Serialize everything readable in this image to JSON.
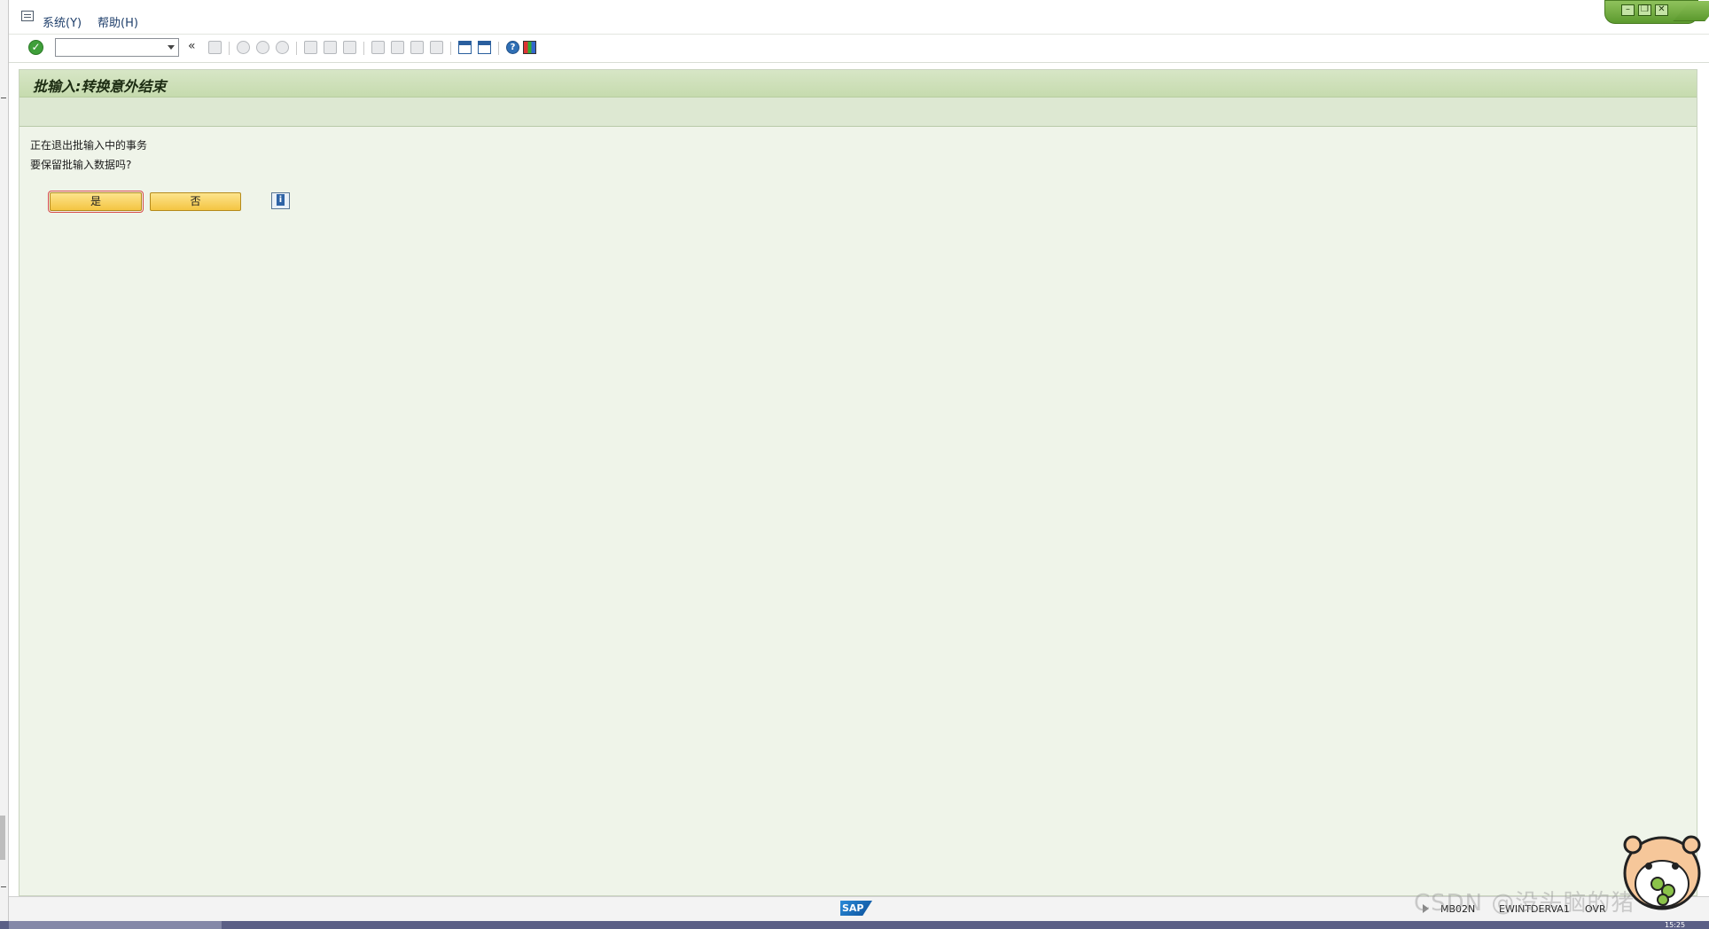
{
  "menu": {
    "items": [
      {
        "label": "系统(Y)"
      },
      {
        "label": "帮助(H)"
      }
    ]
  },
  "toolbar": {
    "command_field_value": "",
    "back_glyph": "«"
  },
  "page": {
    "title": "批输入:转换意外结束",
    "messages": [
      "正在退出批输入中的事务",
      "要保留批输入数据吗?"
    ],
    "buttons": {
      "yes": "是",
      "no": "否"
    }
  },
  "statusbar": {
    "brand": "SAP",
    "transaction": "MB02N",
    "server": "EWINTDERVA1",
    "mode": "OVR"
  },
  "taskbar": {
    "clock": "15:25"
  },
  "watermark": {
    "text": "CSDN @没头脑的猪"
  },
  "colors": {
    "content_bg": "#eff4e9",
    "title_bar": "#c6dbae",
    "button_yellow": "#f4c542",
    "window_controls_green": "#5c9a2e"
  }
}
